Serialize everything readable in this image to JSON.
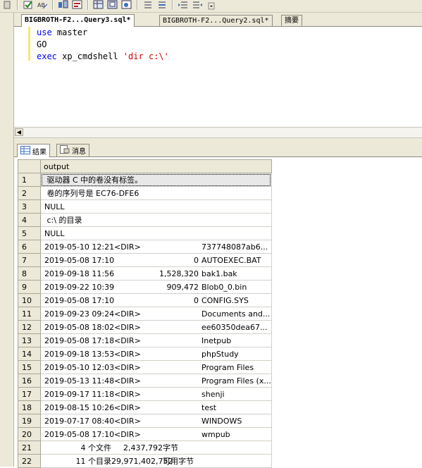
{
  "toolbar": {
    "icons": [
      "toolbar-dropdown-icon",
      "check-icon",
      "abc-icon",
      "query-options-icon",
      "results-to-text-icon",
      "results-to-grid-icon",
      "results-to-file-icon",
      "comment-icon",
      "uncomment-icon",
      "decrease-indent-icon",
      "increase-indent-icon",
      "overflow-icon"
    ]
  },
  "tabs": [
    {
      "label": "BIGBROTH-F2...Query3.sql*",
      "active": true
    },
    {
      "label": "BIGBROTH-F2...Query2.sql*",
      "active": false
    },
    {
      "label": "摘要",
      "active": false
    }
  ],
  "editor": {
    "lines": [
      {
        "kw": "use",
        "rest": " master",
        "str": ""
      },
      {
        "kw": "",
        "rest": "GO",
        "str": ""
      },
      {
        "kw": "exec",
        "rest": " xp_cmdshell ",
        "str": "'dir c:\\'"
      }
    ],
    "colors": {
      "keyword": "#0000ff",
      "string": "#cc0000"
    }
  },
  "result_tabs": [
    {
      "label": "结果",
      "icon": "grid-icon",
      "active": true
    },
    {
      "label": "消息",
      "icon": "messages-icon",
      "active": false
    }
  ],
  "grid": {
    "column": "output",
    "rows": [
      {
        "n": "1",
        "text": " 驱动器 C 中的卷没有标签。"
      },
      {
        "n": "2",
        "text": " 卷的序列号是 EC76-DFE6"
      },
      {
        "n": "3",
        "text": "NULL"
      },
      {
        "n": "4",
        "text": " c:\\ 的目录"
      },
      {
        "n": "5",
        "text": "NULL"
      },
      {
        "n": "6",
        "date": "2019-05-10  12:21",
        "mid": "<DIR>",
        "size": "",
        "name": "737748087ab6..."
      },
      {
        "n": "7",
        "date": "2019-05-08  17:10",
        "mid": "",
        "size": "0",
        "name": "AUTOEXEC.BAT"
      },
      {
        "n": "8",
        "date": "2019-09-18  11:56",
        "mid": "",
        "size": "1,528,320",
        "name": "bak1.bak"
      },
      {
        "n": "9",
        "date": "2019-09-22  10:39",
        "mid": "",
        "size": "909,472",
        "name": "Blob0_0.bin"
      },
      {
        "n": "10",
        "date": "2019-05-08  17:10",
        "mid": "",
        "size": "0",
        "name": "CONFIG.SYS"
      },
      {
        "n": "11",
        "date": "2019-09-23  09:24",
        "mid": "<DIR>",
        "size": "",
        "name": "Documents and..."
      },
      {
        "n": "12",
        "date": "2019-05-08  18:02",
        "mid": "<DIR>",
        "size": "",
        "name": "ee60350dea67..."
      },
      {
        "n": "13",
        "date": "2019-05-08  17:18",
        "mid": "<DIR>",
        "size": "",
        "name": "Inetpub"
      },
      {
        "n": "14",
        "date": "2019-09-18  13:53",
        "mid": "<DIR>",
        "size": "",
        "name": "phpStudy"
      },
      {
        "n": "15",
        "date": "2019-05-10  12:03",
        "mid": "<DIR>",
        "size": "",
        "name": "Program Files"
      },
      {
        "n": "16",
        "date": "2019-05-13  11:48",
        "mid": "<DIR>",
        "size": "",
        "name": "Program Files (x..."
      },
      {
        "n": "17",
        "date": "2019-09-17  11:18",
        "mid": "<DIR>",
        "size": "",
        "name": "shenji"
      },
      {
        "n": "18",
        "date": "2019-08-15  10:26",
        "mid": "<DIR>",
        "size": "",
        "name": "test"
      },
      {
        "n": "19",
        "date": "2019-07-17  08:40",
        "mid": "<DIR>",
        "size": "",
        "name": "WINDOWS"
      },
      {
        "n": "20",
        "date": "2019-05-08  17:10",
        "mid": "<DIR>",
        "size": "",
        "name": "wmpub"
      },
      {
        "n": "21",
        "left": "4 个文件",
        "size": "2,437,792",
        "name": "字节"
      },
      {
        "n": "22",
        "left": "11 个目录",
        "size": "29,971,402,752",
        "name": "可用字节"
      }
    ]
  }
}
